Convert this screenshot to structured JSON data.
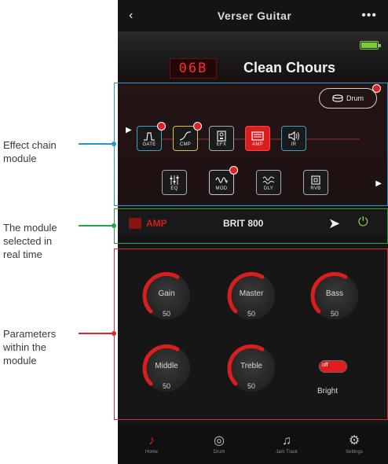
{
  "header": {
    "back": "‹",
    "title": "Verser Guitar",
    "more": "•••"
  },
  "preset": {
    "number": "06B",
    "name": "Clean Chours",
    "battery_level": 1.0
  },
  "chain": {
    "drum_label": "Drum",
    "row1": [
      {
        "label": "GATE",
        "icon": "gate-icon",
        "has_badge": true
      },
      {
        "label": "CMP",
        "icon": "compressor-icon",
        "has_badge": true
      },
      {
        "label": "EFX",
        "icon": "efx-icon",
        "has_badge": false
      },
      {
        "label": "AMP",
        "icon": "amp-icon",
        "has_badge": false,
        "active": true
      },
      {
        "label": "IR",
        "icon": "speaker-icon",
        "has_badge": false
      }
    ],
    "row2": [
      {
        "label": "EQ",
        "icon": "eq-sliders-icon",
        "has_badge": false
      },
      {
        "label": "MOD",
        "icon": "wave-icon",
        "has_badge": true
      },
      {
        "label": "DLY",
        "icon": "delay-icon",
        "has_badge": false
      },
      {
        "label": "RVB",
        "icon": "reverb-icon",
        "has_badge": false
      }
    ]
  },
  "selected": {
    "type_label": "AMP",
    "model": "BRIT 800"
  },
  "params": {
    "knobs": [
      {
        "name": "Gain",
        "value": "50"
      },
      {
        "name": "Master",
        "value": "50"
      },
      {
        "name": "Bass",
        "value": "50"
      },
      {
        "name": "Middle",
        "value": "50"
      },
      {
        "name": "Treble",
        "value": "50"
      }
    ],
    "toggle": {
      "state_label": "off",
      "name": "Bright"
    }
  },
  "nav": [
    {
      "label": "Home",
      "icon": "guitar-icon",
      "active": true
    },
    {
      "label": "Drum",
      "icon": "drum-icon",
      "active": false
    },
    {
      "label": "Jam Track",
      "icon": "music-note-icon",
      "active": false
    },
    {
      "label": "Settings",
      "icon": "gear-icon",
      "active": false
    }
  ],
  "annotations": {
    "a1": "Effect chain\nmodule",
    "a2": "The module\nselected in\nreal time",
    "a3": "Parameters\nwithin the\nmodule"
  },
  "colors": {
    "accent_red": "#d81e1e",
    "active_power": "#8fd24a",
    "annot_blue": "#1f9ad6",
    "annot_green": "#22a845",
    "annot_red": "#d8272e"
  }
}
